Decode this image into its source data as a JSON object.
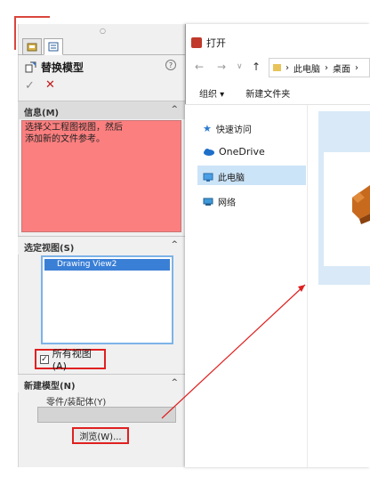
{
  "property_manager": {
    "title": "替换模型",
    "help_symbol": "?",
    "ok_symbol": "✓",
    "cancel_symbol": "✕",
    "info_section": {
      "header": "信息(M)",
      "message_line1": "选择父工程图视图，然后",
      "message_line2": "添加新的文件参考。"
    },
    "views_section": {
      "header": "选定视图(S)",
      "items": [
        "Drawing View2"
      ],
      "all_views_label": "所有视图(A)",
      "all_views_checked": true
    },
    "new_model_section": {
      "header": "新建模型(N)",
      "component_label": "零件/装配体(Y)",
      "component_value": "",
      "browse_label": "浏览(W)..."
    }
  },
  "open_dialog": {
    "title": "打开",
    "address": [
      "此电脑",
      "桌面"
    ],
    "toolbar": {
      "organize": "组织 ▾",
      "new_folder": "新建文件夹"
    },
    "nav_items": [
      "快速访问",
      "OneDrive",
      "此电脑",
      "网络"
    ],
    "selected_nav": "此电脑"
  },
  "colors": {
    "info_background": "#fb7f7f",
    "highlight_border": "#e02020",
    "selection": "#3a7fd6"
  }
}
